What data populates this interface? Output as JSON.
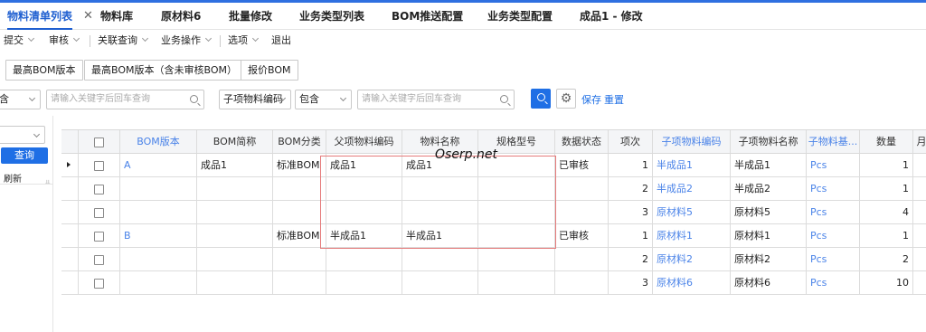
{
  "tabs": [
    {
      "label": "物料清单列表",
      "active": true,
      "close": "✕"
    },
    {
      "label": "物料库"
    },
    {
      "label": "原材料6"
    },
    {
      "label": "批量修改"
    },
    {
      "label": "业务类型列表"
    },
    {
      "label": "BOM推送配置"
    },
    {
      "label": "业务类型配置"
    },
    {
      "label": "成品1 - 修改"
    }
  ],
  "menu": {
    "submit": "提交",
    "review": "审核",
    "related_query": "关联查询",
    "business_ops": "业务操作",
    "options": "选项",
    "exit": "退出"
  },
  "buttons": {
    "latest_bom": "最高BOM版本",
    "latest_bom_incl": "最高BOM版本（含未审核BOM）",
    "quote_bom": "报价BOM"
  },
  "filter": {
    "cond1_value": "含",
    "input1_placeholder": "请输入关键字后回车查询",
    "field2": "子项物料编码",
    "op2": "包含",
    "input2_placeholder": "请输入关键字后回车查询",
    "save": "保存",
    "reset": "重置"
  },
  "left_panel": {
    "query": "查询",
    "refresh": "刷新"
  },
  "watermark": "Oserp.net",
  "table": {
    "headers": [
      "BOM版本",
      "BOM简称",
      "BOM分类",
      "父项物料编码",
      "物料名称",
      "规格型号",
      "数据状态",
      "项次",
      "子项物料编码",
      "子项物料名称",
      "子物料基...",
      "数量",
      "月"
    ],
    "rows": [
      {
        "bom_version": "A",
        "bom_name": "成品1",
        "bom_type": "标准BOM",
        "parent_code": "成品1",
        "material_name": "成品1",
        "spec": "",
        "status": "已审核",
        "item_no": "1",
        "child_code": "半成品1",
        "child_name": "半成品1",
        "unit": "Pcs",
        "qty": "1"
      },
      {
        "bom_version": "",
        "bom_name": "",
        "bom_type": "",
        "parent_code": "",
        "material_name": "",
        "spec": "",
        "status": "",
        "item_no": "2",
        "child_code": "半成品2",
        "child_name": "半成品2",
        "unit": "Pcs",
        "qty": "1"
      },
      {
        "bom_version": "",
        "bom_name": "",
        "bom_type": "",
        "parent_code": "",
        "material_name": "",
        "spec": "",
        "status": "",
        "item_no": "3",
        "child_code": "原材料5",
        "child_name": "原材料5",
        "unit": "Pcs",
        "qty": "4"
      },
      {
        "bom_version": "B",
        "bom_name": "",
        "bom_type": "标准BOM",
        "parent_code": "半成品1",
        "material_name": "半成品1",
        "spec": "",
        "status": "已审核",
        "item_no": "1",
        "child_code": "原材料1",
        "child_name": "原材料1",
        "unit": "Pcs",
        "qty": "1"
      },
      {
        "bom_version": "",
        "bom_name": "",
        "bom_type": "",
        "parent_code": "",
        "material_name": "",
        "spec": "",
        "status": "",
        "item_no": "2",
        "child_code": "原材料2",
        "child_name": "原材料2",
        "unit": "Pcs",
        "qty": "2"
      },
      {
        "bom_version": "",
        "bom_name": "",
        "bom_type": "",
        "parent_code": "",
        "material_name": "",
        "spec": "",
        "status": "",
        "item_no": "3",
        "child_code": "原材料6",
        "child_name": "原材料6",
        "unit": "Pcs",
        "qty": "10"
      }
    ]
  },
  "colors": {
    "accent": "#1f6fe5",
    "link_blue": "#4a83e8",
    "highlight_box": "#e57b7b"
  }
}
